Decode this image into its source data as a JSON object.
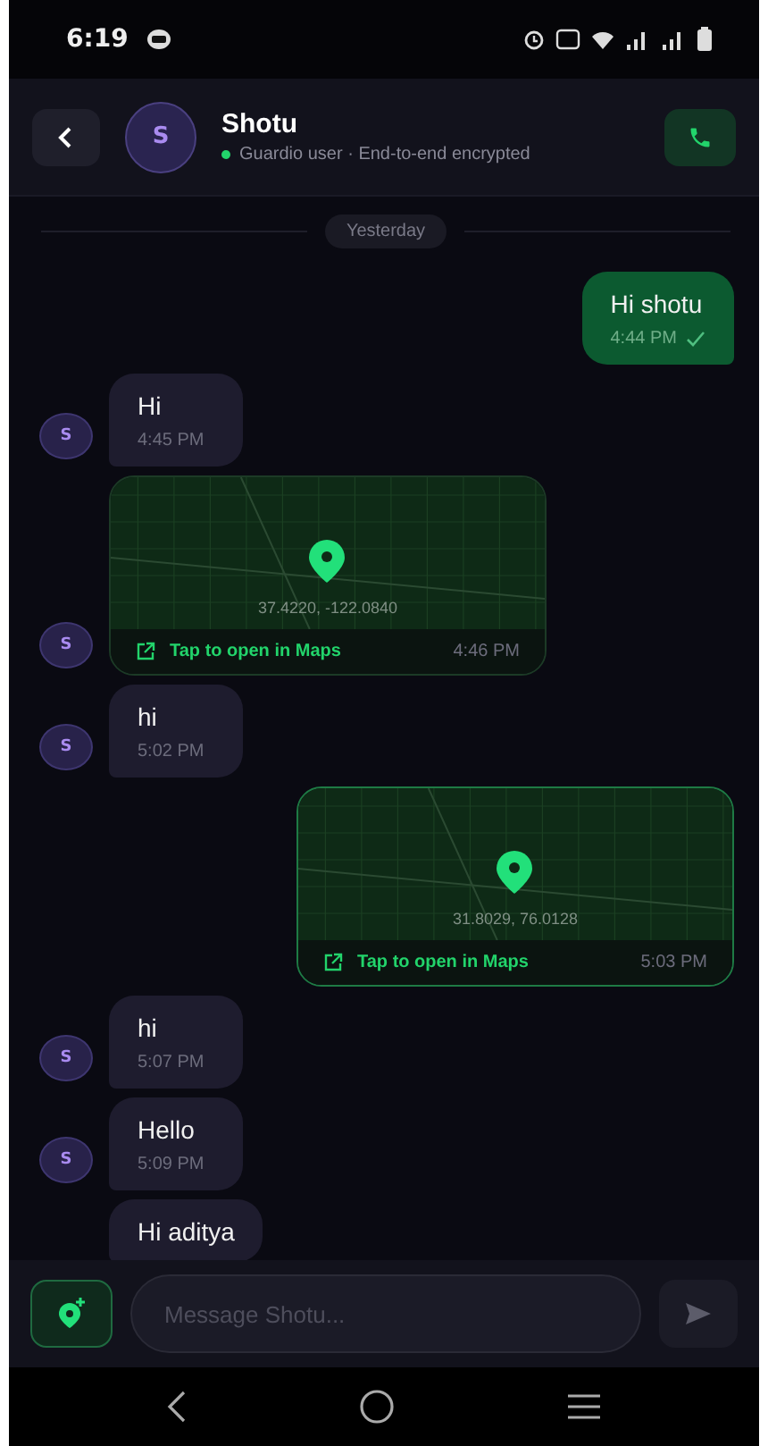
{
  "status_bar": {
    "time": "6:19"
  },
  "header": {
    "avatar": "S",
    "name": "Shotu",
    "online": true,
    "subtitle": "Guardio user · End-to-end encrypted"
  },
  "date_divider": "Yesterday",
  "messages": [
    {
      "kind": "text",
      "outgoing": true,
      "text": "Hi shotu",
      "time": "4:44 PM",
      "read": true
    },
    {
      "kind": "text",
      "outgoing": false,
      "text": "Hi",
      "time": "4:45 PM",
      "avatar": "S"
    },
    {
      "kind": "location",
      "outgoing": false,
      "coords": "37.4220, -122.0840",
      "link": "Tap to open in Maps",
      "time": "4:46 PM",
      "avatar": "S"
    },
    {
      "kind": "text",
      "outgoing": false,
      "text": "hi",
      "time": "5:02 PM",
      "avatar": "S"
    },
    {
      "kind": "location",
      "outgoing": true,
      "coords": "31.8029, 76.0128",
      "link": "Tap to open in Maps",
      "time": "5:03 PM"
    },
    {
      "kind": "text",
      "outgoing": false,
      "text": "hi",
      "time": "5:07 PM",
      "avatar": "S"
    },
    {
      "kind": "text",
      "outgoing": false,
      "text": "Hello",
      "time": "5:09 PM",
      "avatar": "S"
    },
    {
      "kind": "text",
      "outgoing": false,
      "text": "Hi aditya"
    }
  ],
  "composer": {
    "placeholder": "Message Shotu..."
  }
}
